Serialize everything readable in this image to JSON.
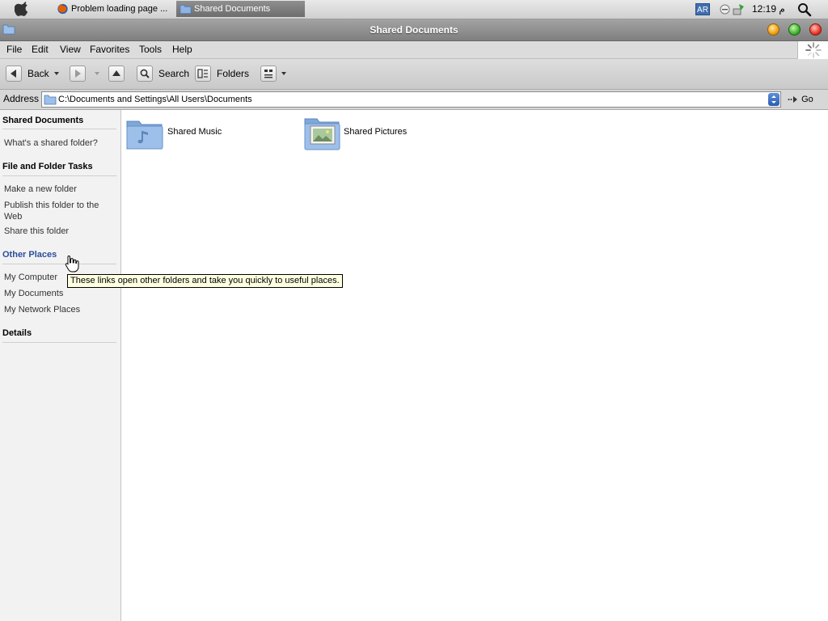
{
  "taskbar": {
    "tasks": [
      {
        "label": "Problem loading page ..."
      },
      {
        "label": "Shared Documents"
      }
    ],
    "lang": "AR",
    "clock": "12:19 م"
  },
  "window": {
    "title": "Shared Documents"
  },
  "menu": {
    "items": [
      "File",
      "Edit",
      "View",
      "Favorites",
      "Tools",
      "Help"
    ]
  },
  "toolbar": {
    "back_label": "Back",
    "search_label": "Search",
    "folders_label": "Folders"
  },
  "address": {
    "label": "Address",
    "path": "C:\\Documents and Settings\\All Users\\Documents",
    "go_label": "Go"
  },
  "sidepane": {
    "sections": [
      {
        "title": "Shared Documents",
        "links": [
          "What's a shared folder?"
        ]
      },
      {
        "title": "File and Folder Tasks",
        "links": [
          "Make a new folder",
          "Publish this folder to the Web",
          "Share this folder"
        ]
      },
      {
        "title": "Other Places",
        "links": [
          "My Computer",
          "My Documents",
          "My Network Places"
        ]
      },
      {
        "title": "Details",
        "links": []
      }
    ]
  },
  "content": {
    "items": [
      {
        "label": "Shared Music",
        "icon": "music-folder-icon"
      },
      {
        "label": "Shared Pictures",
        "icon": "pictures-folder-icon"
      }
    ]
  },
  "tooltip": {
    "text": "These links open other folders and take you quickly to useful places."
  },
  "colors": {
    "accent_link": "#2b4e9e",
    "titlebar": "#8f8f8f",
    "tooltip_bg": "#ffffe1"
  }
}
